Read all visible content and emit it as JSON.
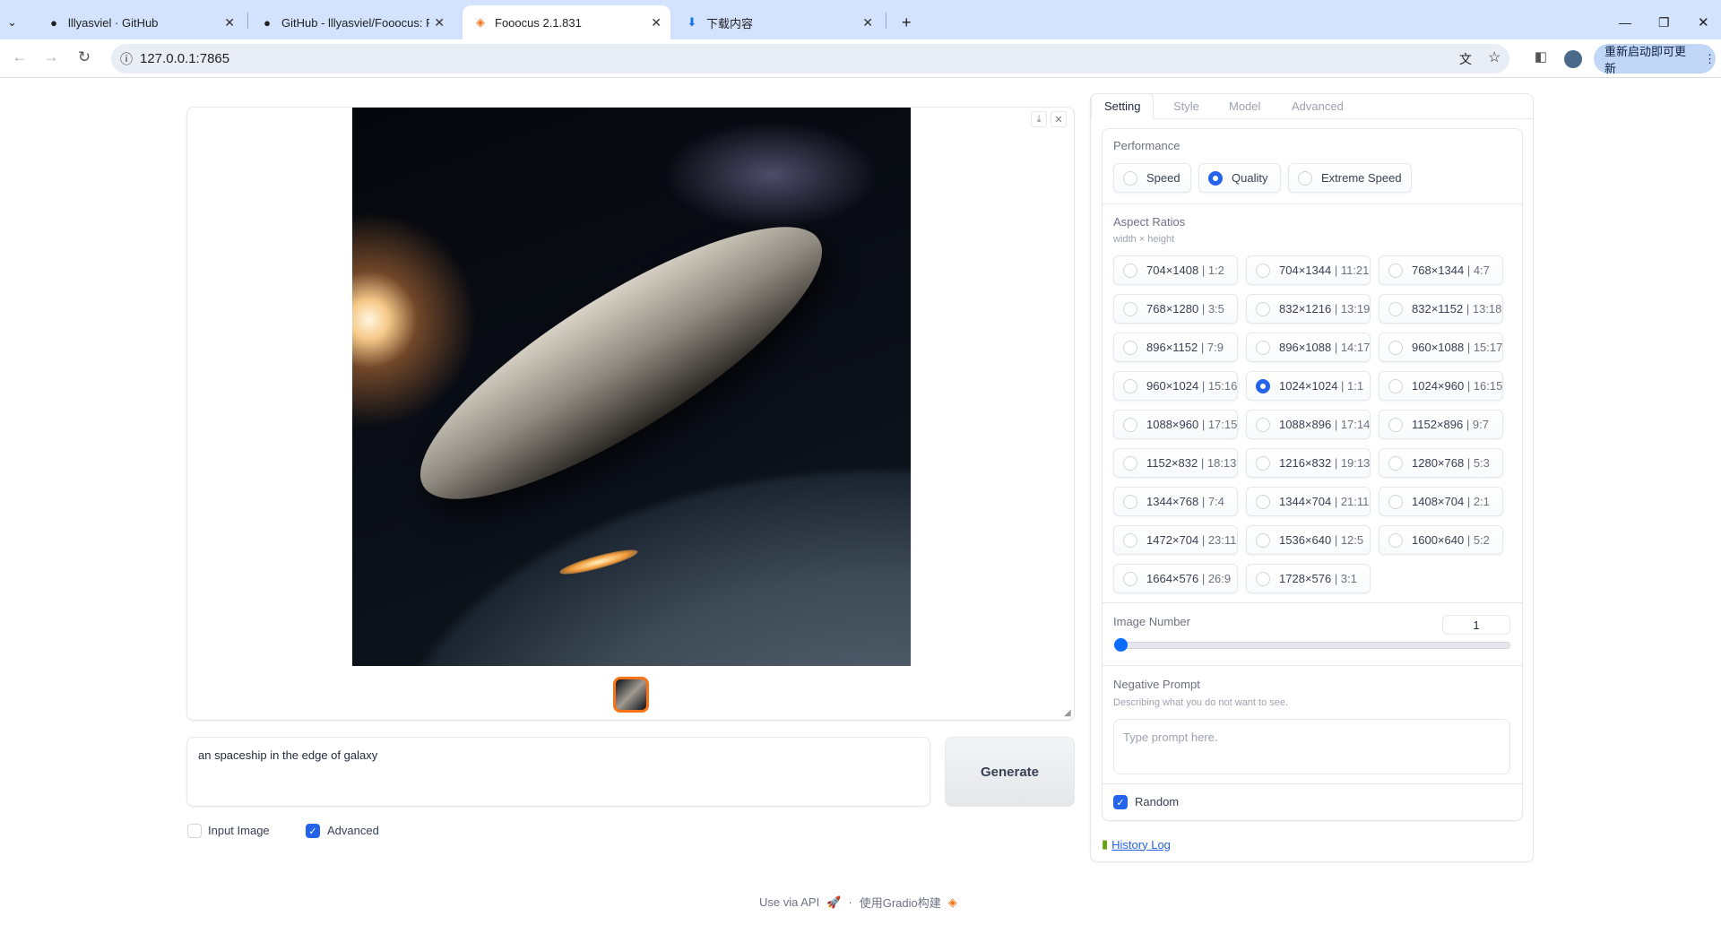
{
  "browser": {
    "tabs": [
      {
        "title": "lllyasviel · GitHub",
        "icon": "github-icon"
      },
      {
        "title": "GitHub - lllyasviel/Fooocus: F",
        "icon": "github-icon"
      },
      {
        "title": "Fooocus 2.1.831",
        "icon": "gradio-icon",
        "active": true
      },
      {
        "title": "下载内容",
        "icon": "download-icon"
      }
    ],
    "url": "127.0.0.1:7865",
    "update_button": "重新启动即可更新"
  },
  "main": {
    "prompt": "an  spaceship in the edge of galaxy",
    "generate_label": "Generate",
    "input_image_label": "Input Image",
    "input_image_checked": false,
    "advanced_label": "Advanced",
    "advanced_checked": true
  },
  "footer": {
    "api": "Use via API",
    "dot": "·",
    "built": "使用Gradio构建"
  },
  "panel": {
    "tabs": [
      "Setting",
      "Style",
      "Model",
      "Advanced"
    ],
    "performance": {
      "label": "Performance",
      "options": [
        "Speed",
        "Quality",
        "Extreme Speed"
      ],
      "selected": "Quality"
    },
    "aspect": {
      "label": "Aspect Ratios",
      "sub": "width × height",
      "selected": "1024×1024",
      "options": [
        [
          "704×1408",
          "1:2"
        ],
        [
          "704×1344",
          "11:21"
        ],
        [
          "768×1344",
          "4:7"
        ],
        [
          "768×1280",
          "3:5"
        ],
        [
          "832×1216",
          "13:19"
        ],
        [
          "832×1152",
          "13:18"
        ],
        [
          "896×1152",
          "7:9"
        ],
        [
          "896×1088",
          "14:17"
        ],
        [
          "960×1088",
          "15:17"
        ],
        [
          "960×1024",
          "15:16"
        ],
        [
          "1024×1024",
          "1:1"
        ],
        [
          "1024×960",
          "16:15"
        ],
        [
          "1088×960",
          "17:15"
        ],
        [
          "1088×896",
          "17:14"
        ],
        [
          "1152×896",
          "9:7"
        ],
        [
          "1152×832",
          "18:13"
        ],
        [
          "1216×832",
          "19:13"
        ],
        [
          "1280×768",
          "5:3"
        ],
        [
          "1344×768",
          "7:4"
        ],
        [
          "1344×704",
          "21:11"
        ],
        [
          "1408×704",
          "2:1"
        ],
        [
          "1472×704",
          "23:11"
        ],
        [
          "1536×640",
          "12:5"
        ],
        [
          "1600×640",
          "5:2"
        ],
        [
          "1664×576",
          "26:9"
        ],
        [
          "1728×576",
          "3:1"
        ]
      ]
    },
    "image_number": {
      "label": "Image Number",
      "value": "1",
      "slider_fraction": 0
    },
    "negative": {
      "label": "Negative Prompt",
      "sub": "Describing what you do not want to see.",
      "placeholder": "Type prompt here."
    },
    "random_label": "Random",
    "random_checked": true,
    "history_log": "History Log"
  }
}
